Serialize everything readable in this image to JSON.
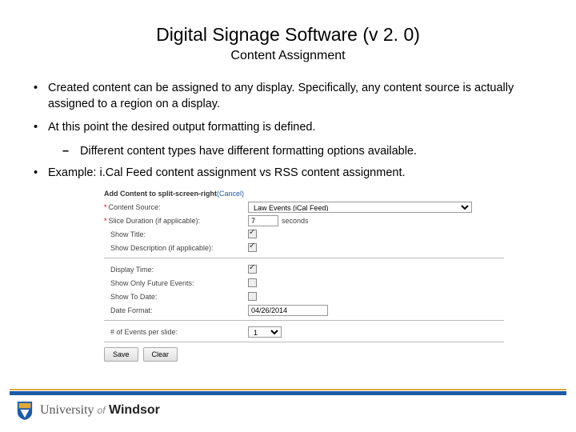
{
  "title": "Digital Signage Software (v 2. 0)",
  "subtitle": "Content Assignment",
  "bullets": {
    "b1": "Created content can be assigned to any display. Specifically, any content source is actually assigned to a region on a display.",
    "b2": "At this point the desired output formatting is defined.",
    "b2a": "Different content types have different formatting options available.",
    "b3": "Example: i.Cal Feed content assignment vs RSS content assignment."
  },
  "form": {
    "header_prefix": "Add Content to split-screen-right",
    "cancel": "(Cancel)",
    "labels": {
      "content_source": "Content Source:",
      "slice_duration": "Slice Duration (if applicable):",
      "show_title": "Show Title:",
      "show_desc": "Show Description (if applicable):",
      "display_time": "Display Time:",
      "future_events": "Show Only Future Events:",
      "show_to_date": "Show To Date:",
      "date_format": "Date Format:",
      "events_per_slide": "# of Events per slide:"
    },
    "values": {
      "content_source": "Law Events (iCal Feed)",
      "slice_duration": "7",
      "seconds": "seconds",
      "date_format": "04/26/2014",
      "events_per_slide": "1"
    },
    "buttons": {
      "save": "Save",
      "clear": "Clear"
    }
  },
  "footer": {
    "university": "University",
    "of": "of",
    "windsor": "Windsor"
  }
}
